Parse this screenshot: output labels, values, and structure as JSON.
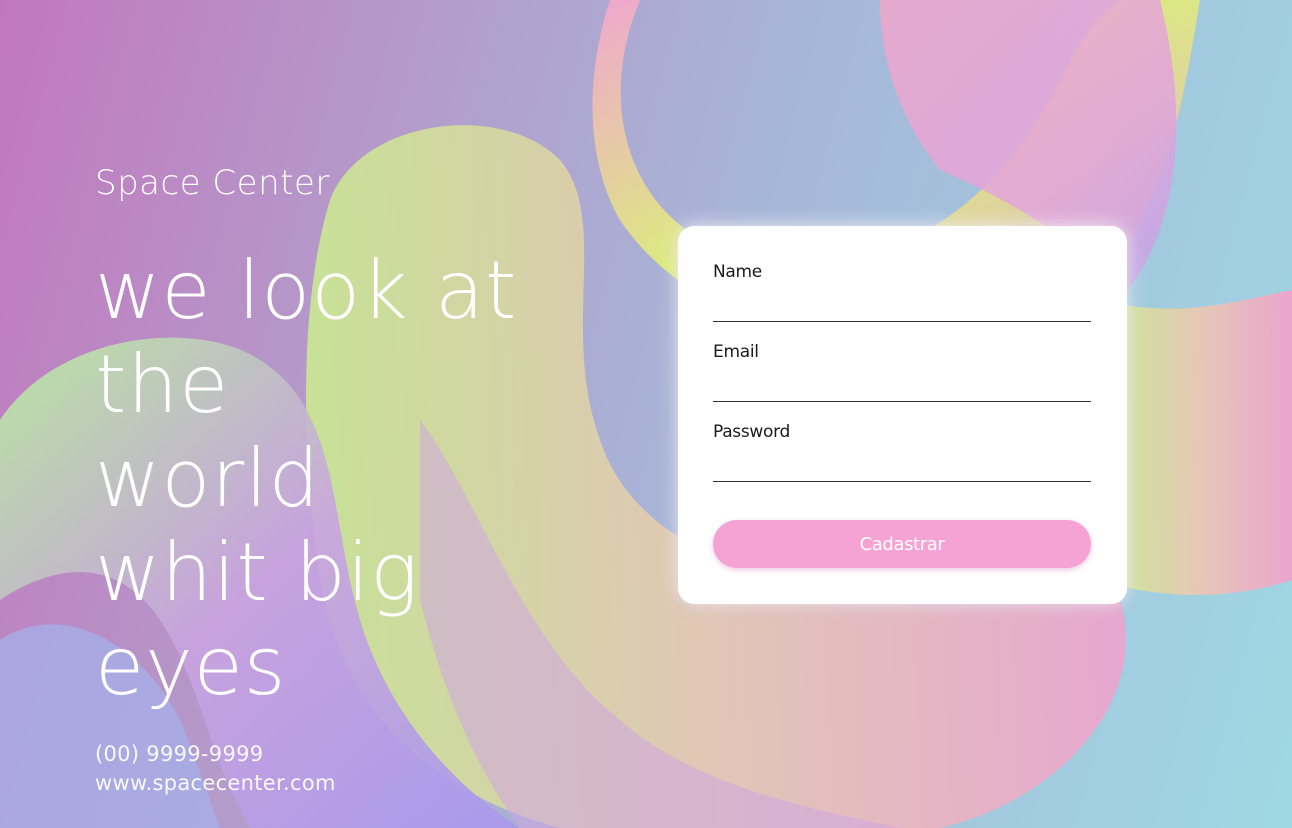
{
  "brand": {
    "name": "Space Center"
  },
  "hero": {
    "headline_lines": [
      "we look at the",
      "world",
      "whit big eyes"
    ]
  },
  "contact": {
    "phone": "(00) 9999-9999",
    "website": "www.spacecenter.com"
  },
  "form": {
    "fields": [
      {
        "label": "Name",
        "value": ""
      },
      {
        "label": "Email",
        "value": ""
      },
      {
        "label": "Password",
        "value": ""
      }
    ],
    "submit_label": "Cadastrar"
  },
  "colors": {
    "button": "#f4a3d4",
    "text_light": "#ffffff",
    "card": "#ffffff"
  }
}
